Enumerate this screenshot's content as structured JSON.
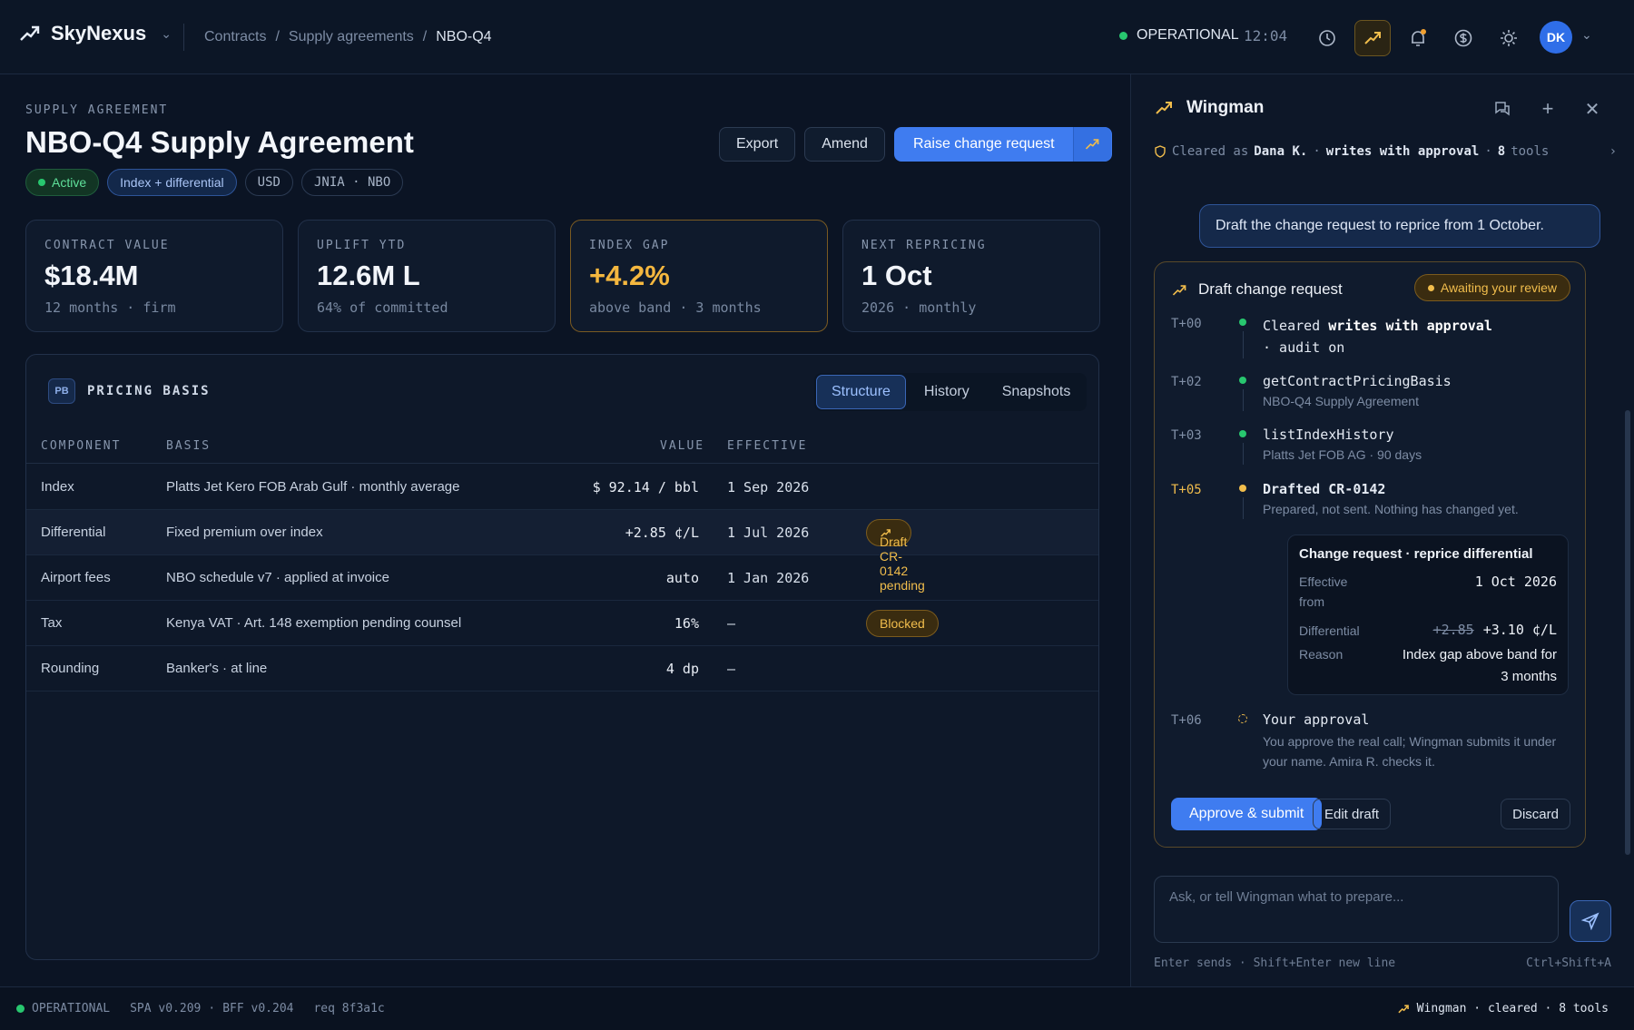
{
  "brand": {
    "name": "SkyNexus"
  },
  "breadcrumb": [
    "Contracts",
    "Supply agreements",
    "NBO-Q4"
  ],
  "topbar": {
    "status": "OPERATIONAL",
    "time": "12:04",
    "avatar_initials": "DK"
  },
  "header": {
    "kicker": "SUPPLY AGREEMENT",
    "title": "NBO-Q4 Supply Agreement",
    "tags": {
      "active": "Active",
      "pricing": "Index + differential",
      "currency": "USD",
      "route": "JNIA · NBO"
    },
    "actions": {
      "export": "Export",
      "amend": "Amend",
      "raise": "Raise change request"
    }
  },
  "kpis": [
    {
      "label": "CONTRACT VALUE",
      "value": "$18.4M",
      "sub": "12 months · firm"
    },
    {
      "label": "UPLIFT YTD",
      "value": "12.6M L",
      "sub": "64% of committed"
    },
    {
      "label": "INDEX GAP",
      "value": "+4.2%",
      "sub": "above band · 3 months"
    },
    {
      "label": "NEXT REPRICING",
      "value": "1 Oct",
      "sub": "2026 · monthly"
    }
  ],
  "pricing": {
    "badge": "PB",
    "title": "PRICING BASIS",
    "tabs": [
      "Structure",
      "History",
      "Snapshots"
    ],
    "columns": [
      "COMPONENT",
      "BASIS",
      "VALUE",
      "EFFECTIVE"
    ],
    "rows": [
      {
        "component": "Index",
        "basis": "Platts Jet Kero FOB Arab Gulf · monthly average",
        "value": "$ 92.14 / bbl",
        "effective": "1 Sep 2026",
        "badge": ""
      },
      {
        "component": "Differential",
        "basis": "Fixed premium over index",
        "value": "+2.85 ¢/L",
        "effective": "1 Jul 2026",
        "badge": "Draft CR-0142 pending"
      },
      {
        "component": "Airport fees",
        "basis": "NBO schedule v7 · applied at invoice",
        "value": "auto",
        "effective": "1 Jan 2026",
        "badge": ""
      },
      {
        "component": "Tax",
        "basis": "Kenya VAT · Art. 148 exemption pending counsel",
        "value": "16%",
        "effective": "—",
        "badge": "Blocked"
      },
      {
        "component": "Rounding",
        "basis": "Banker's · at line",
        "value": "4 dp",
        "effective": "—",
        "badge": ""
      }
    ]
  },
  "wingman": {
    "title": "Wingman",
    "cleared": {
      "prefix": "Cleared as",
      "user": "Dana K.",
      "mode": "writes with approval",
      "tools": "8",
      "tools_label": "tools"
    },
    "prompt": "Draft the change request to reprice from 1 October.",
    "card": {
      "title": "Draft change request",
      "status": "Awaiting your review",
      "steps": [
        {
          "t": "T+00",
          "head_a": "Cleared ",
          "head_b": "writes with approval",
          "head_c": "· audit on",
          "sub": ""
        },
        {
          "t": "T+02",
          "head": "getContractPricingBasis",
          "sub": "NBO-Q4 Supply Agreement"
        },
        {
          "t": "T+03",
          "head": "listIndexHistory",
          "sub": "Platts Jet FOB AG · 90 days"
        },
        {
          "t": "T+05",
          "head": "Drafted CR-0142",
          "sub": "Prepared, not sent. Nothing has changed yet."
        },
        {
          "t": "T+06",
          "head": "Your approval",
          "sub": "You approve the real call; Wingman submits it under your name. Amira R. checks it."
        }
      ],
      "change_request": {
        "title": "Change request · reprice differential",
        "effective_label": "Effective from",
        "effective_value": "1 Oct 2026",
        "diff_label": "Differential",
        "diff_old": "+2.85",
        "diff_new": "+3.10 ¢/L",
        "reason_label": "Reason",
        "reason_value": "Index gap above band for 3 months"
      },
      "approve": "Approve & submit",
      "edit": "Edit draft",
      "discard": "Discard"
    },
    "input_placeholder": "Ask, or tell Wingman what to prepare...",
    "hint_left": "Enter sends · Shift+Enter new line",
    "hint_right": "Ctrl+Shift+A"
  },
  "footer": {
    "status": "OPERATIONAL",
    "spa": "SPA v0.209",
    "bff": "BFF v0.204",
    "req": "req 8f3a1c",
    "right": "Wingman · cleared · 8 tools"
  },
  "colors": {
    "accent": "#3f7cf0",
    "ok": "#28c76f",
    "warn": "#f1bd4c"
  }
}
